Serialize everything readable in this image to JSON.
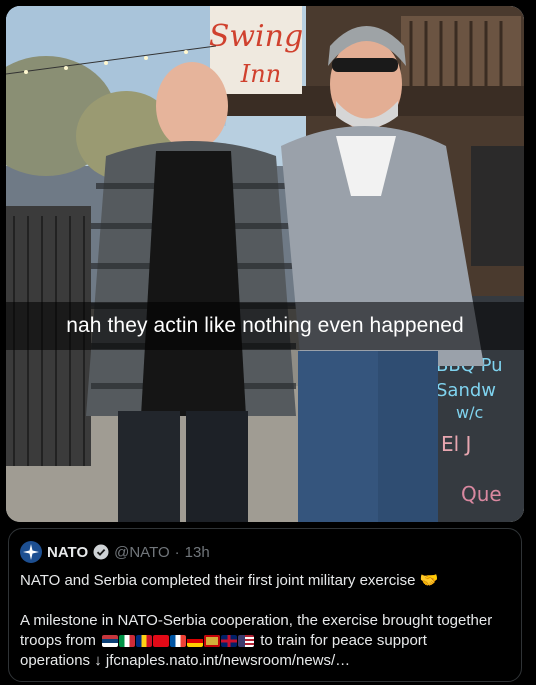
{
  "photo": {
    "caption": "nah they actin like nothing even happened",
    "sign_lines": [
      "Swing",
      "Inn"
    ],
    "board_lines": [
      "BBQ Pu",
      "Sandw",
      "w/c",
      "El J",
      "Que"
    ]
  },
  "quote": {
    "author_name": "NATO",
    "author_handle": "@NATO",
    "separator": "·",
    "time": "13h",
    "headline": "NATO and Serbia completed their first joint military exercise 🤝",
    "body_line1": "A milestone in NATO-Serbia cooperation, the exercise brought together",
    "body_line2_prefix": "troops from",
    "body_line2_suffix": "to train for peace support",
    "body_line3": "operations ↓ jfcnaples.nato.int/newsroom/news/…",
    "flags": [
      "serbia-flag",
      "italy-flag",
      "romania-flag",
      "turkey-flag",
      "france-flag",
      "germany-flag",
      "montenegro-flag",
      "uk-flag",
      "usa-flag"
    ]
  },
  "colors": {
    "background": "#000000",
    "text": "#e7e9ea",
    "muted": "#71767b",
    "verified": "#1d9bf0",
    "border": "#2f3336"
  }
}
